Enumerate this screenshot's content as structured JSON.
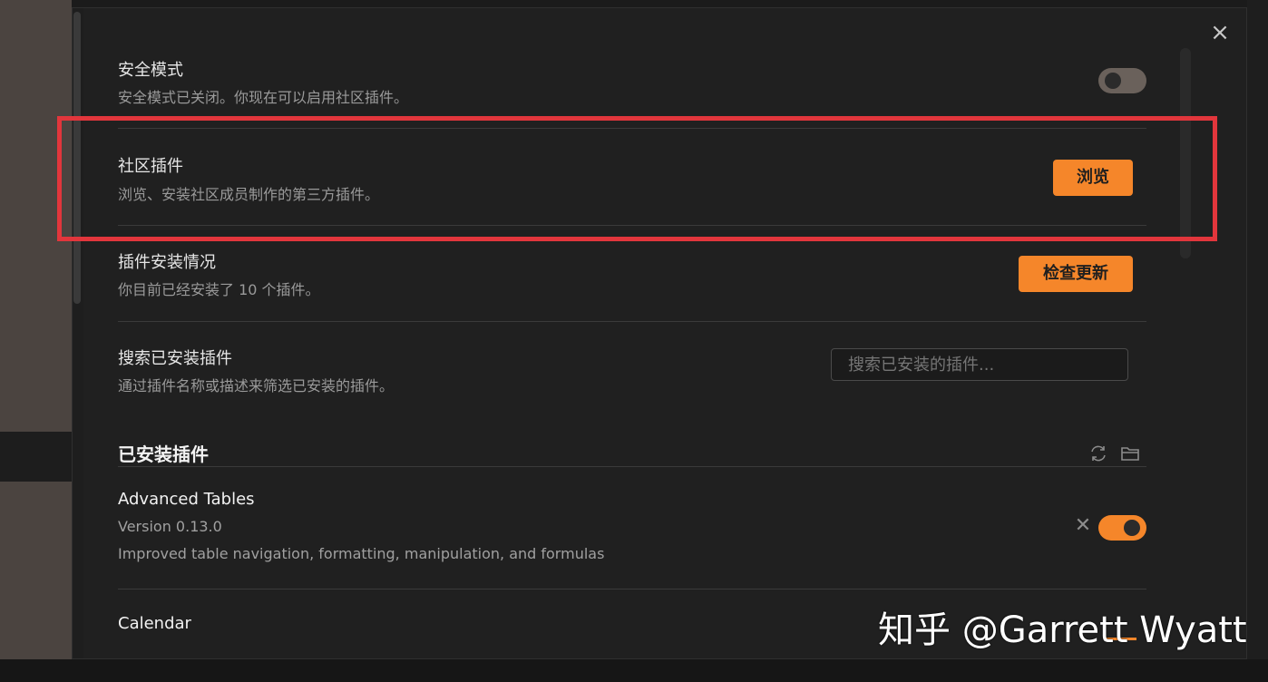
{
  "modal": {
    "close_symbol": "×"
  },
  "settings": {
    "safe_mode": {
      "title": "安全模式",
      "desc": "安全模式已关闭。你现在可以启用社区插件。",
      "toggle_on": false
    },
    "community_plugins": {
      "title": "社区插件",
      "desc": "浏览、安装社区成员制作的第三方插件。",
      "button": "浏览"
    },
    "install_status": {
      "title": "插件安装情况",
      "desc": "你目前已经安装了 10 个插件。",
      "button": "检查更新"
    },
    "search_installed": {
      "title": "搜索已安装插件",
      "desc": "通过插件名称或描述来筛选已安装的插件。",
      "placeholder": "搜索已安装的插件..."
    }
  },
  "installed": {
    "heading": "已安装插件",
    "plugins": [
      {
        "name": "Advanced Tables",
        "version": "Version 0.13.0",
        "desc": "Improved table navigation, formatting, manipulation, and formulas",
        "enabled": true
      },
      {
        "name": "Calendar"
      }
    ]
  },
  "watermark": "知乎 @Garrett Wyatt",
  "colors": {
    "accent": "#f5862a",
    "highlight_border": "#e2363c",
    "background": "#202020"
  },
  "icons": [
    "close-icon",
    "reload-icon",
    "folder-icon",
    "remove-icon"
  ]
}
